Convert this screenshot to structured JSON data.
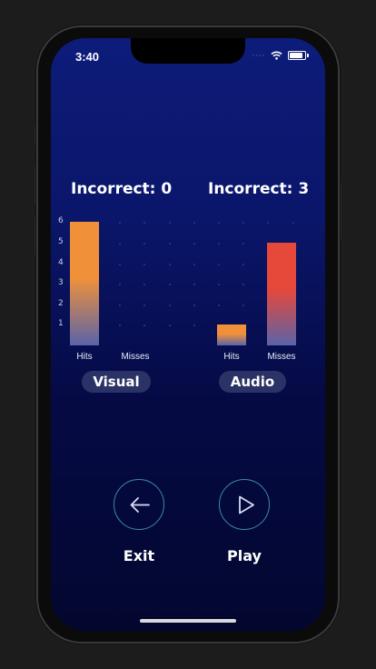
{
  "status_bar": {
    "time": "3:40",
    "signal": "····"
  },
  "visual": {
    "incorrect_label": "Incorrect: 0",
    "section_label": "Visual",
    "bars": [
      {
        "label": "Hits",
        "value": 6,
        "colors": [
          "#f0913a",
          "#5a63a8"
        ]
      },
      {
        "label": "Misses",
        "value": 0,
        "colors": [
          "#e6483a",
          "#5a63a8"
        ]
      }
    ]
  },
  "audio": {
    "incorrect_label": "Incorrect: 3",
    "section_label": "Audio",
    "bars": [
      {
        "label": "Hits",
        "value": 1,
        "colors": [
          "#f0913a",
          "#5a63a8"
        ]
      },
      {
        "label": "Misses",
        "value": 5,
        "colors": [
          "#e6483a",
          "#5a63a8"
        ]
      }
    ]
  },
  "y_ticks": [
    "1",
    "2",
    "3",
    "4",
    "5",
    "6"
  ],
  "chart_data": {
    "type": "bar",
    "categories": [
      "Hits",
      "Misses"
    ],
    "series": [
      {
        "name": "Visual",
        "values": [
          6,
          0
        ]
      },
      {
        "name": "Audio",
        "values": [
          1,
          5
        ]
      }
    ],
    "ylim": [
      0,
      6
    ]
  },
  "actions": {
    "exit_label": "Exit",
    "play_label": "Play",
    "exit_icon": "arrow-left-icon",
    "play_icon": "play-icon"
  },
  "colors": {
    "accent_ring": "#3a8aa8",
    "pill_bg": "#2a3266"
  }
}
